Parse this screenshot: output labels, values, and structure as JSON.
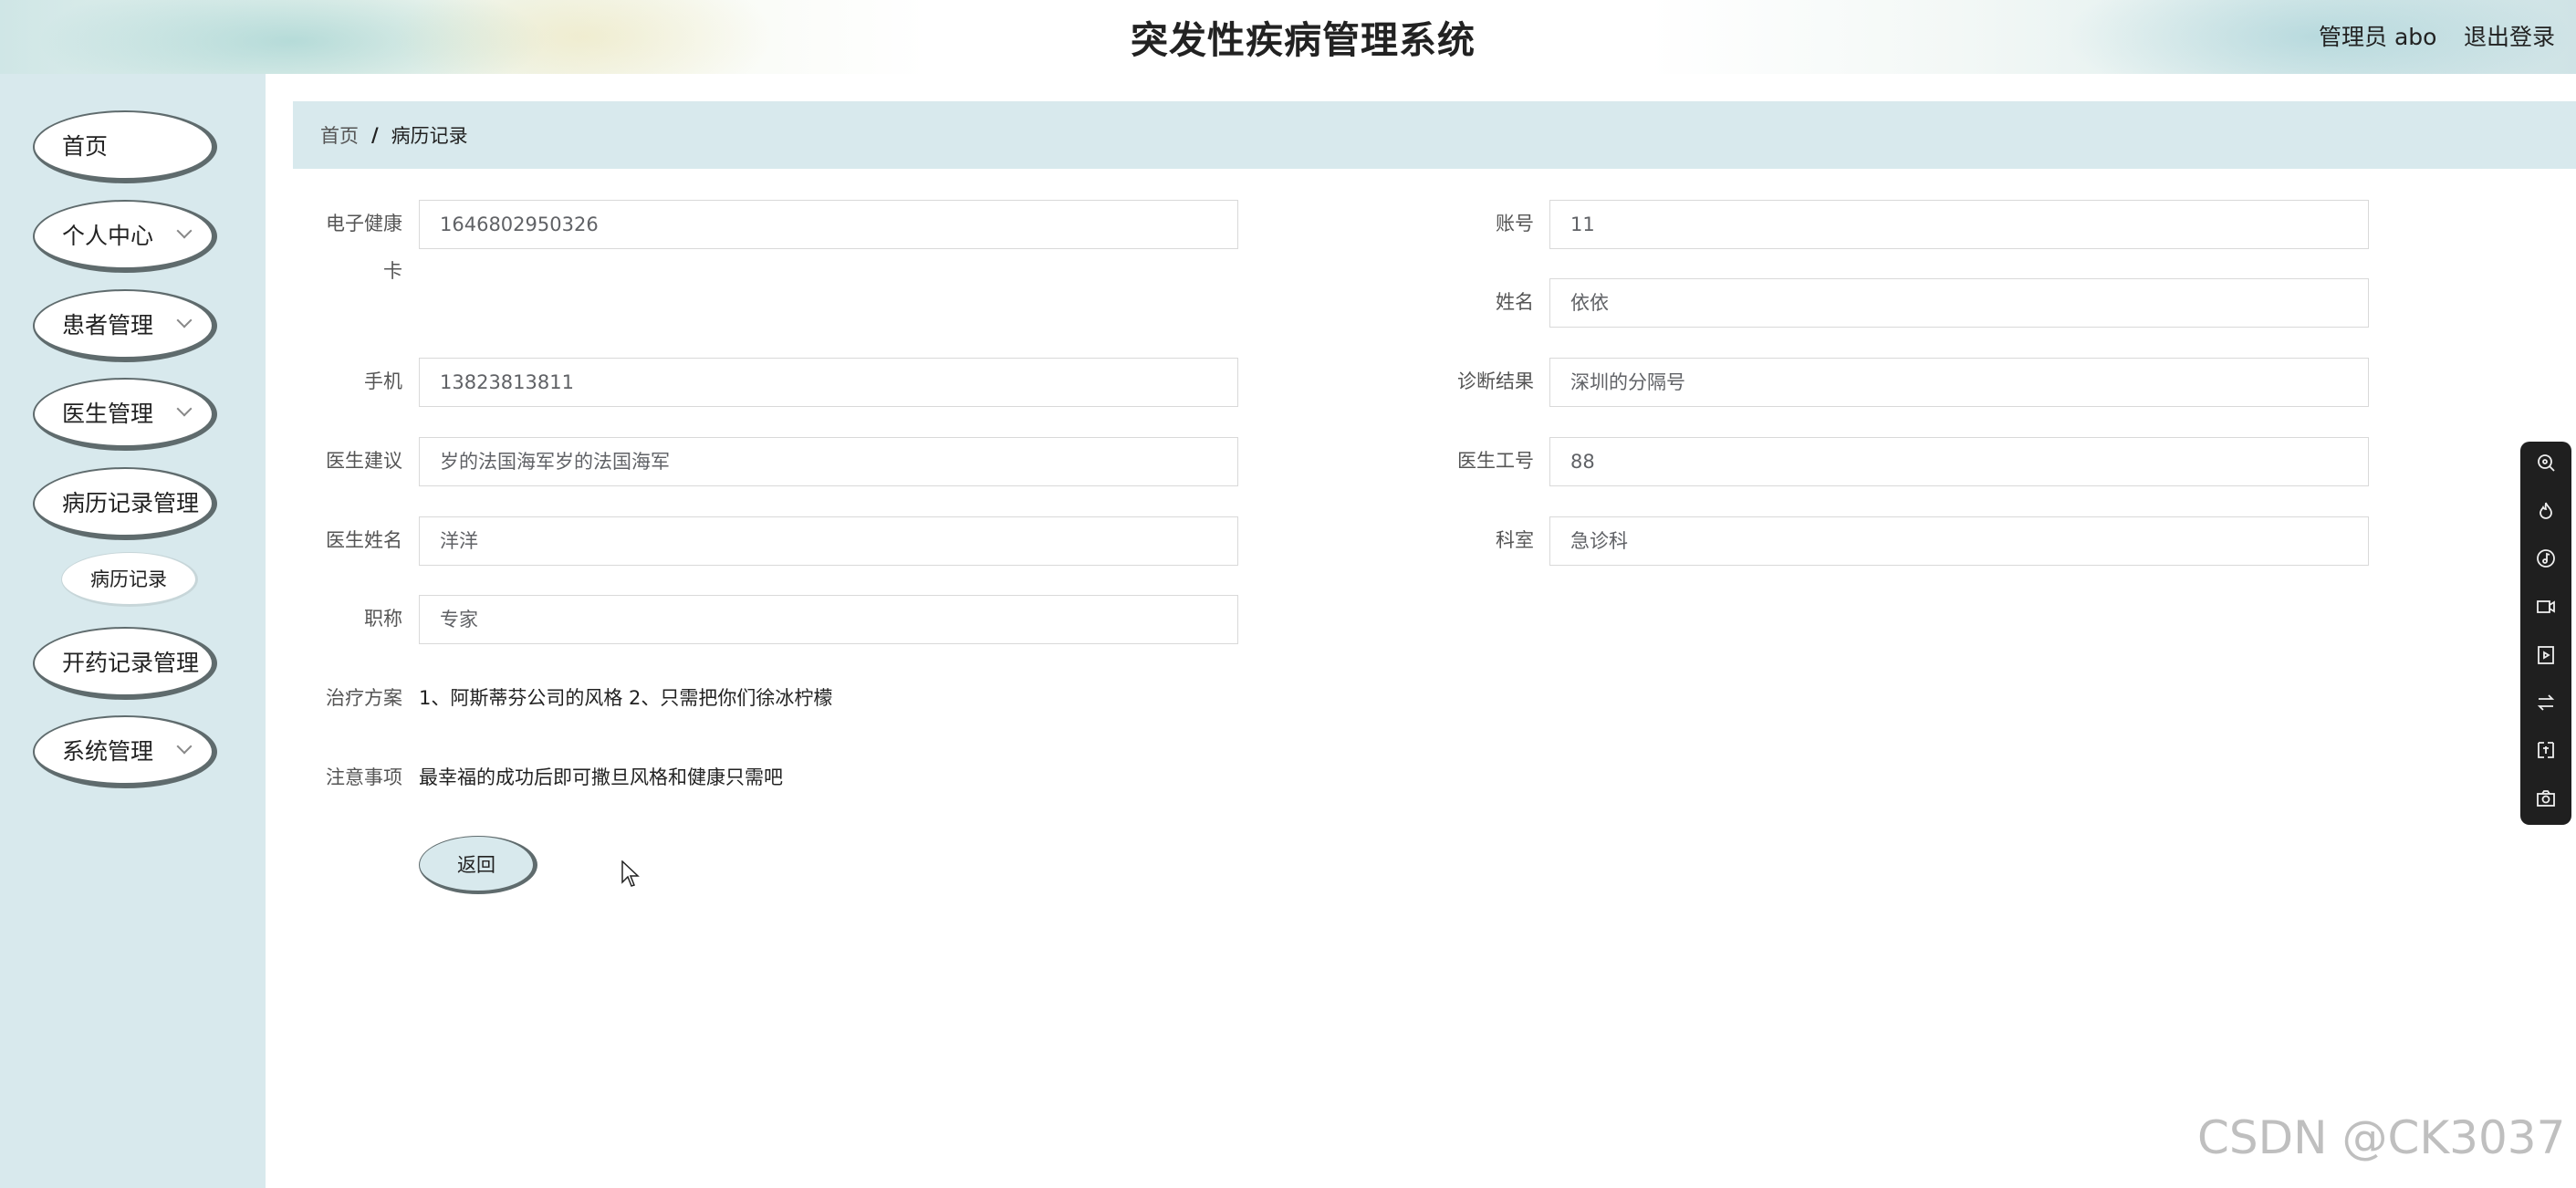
{
  "header": {
    "title": "突发性疾病管理系统",
    "user_label": "管理员 abo",
    "logout_label": "退出登录"
  },
  "sidebar": {
    "items": [
      {
        "label": "首页",
        "has_submenu": false
      },
      {
        "label": "个人中心",
        "has_submenu": true
      },
      {
        "label": "患者管理",
        "has_submenu": true
      },
      {
        "label": "医生管理",
        "has_submenu": true
      },
      {
        "label": "病历记录管理",
        "has_submenu": false
      },
      {
        "label": "开药记录管理",
        "has_submenu": false
      },
      {
        "label": "系统管理",
        "has_submenu": true
      }
    ],
    "subitem": {
      "label": "病历记录"
    }
  },
  "breadcrumb": {
    "home": "首页",
    "separator": "/",
    "current": "病历记录"
  },
  "form": {
    "health_card": {
      "label_line1": "电子健康",
      "label_line2": "卡",
      "value": "1646802950326"
    },
    "account": {
      "label": "账号",
      "value": "11"
    },
    "name": {
      "label": "姓名",
      "value": "依依"
    },
    "phone": {
      "label": "手机",
      "value": "13823813811"
    },
    "diagnosis": {
      "label": "诊断结果",
      "value": "深圳的分隔号"
    },
    "doctor_advice": {
      "label": "医生建议",
      "value": "岁的法国海军岁的法国海军"
    },
    "doctor_id": {
      "label": "医生工号",
      "value": "88"
    },
    "doctor_name": {
      "label": "医生姓名",
      "value": "洋洋"
    },
    "department": {
      "label": "科室",
      "value": "急诊科"
    },
    "title": {
      "label": "职称",
      "value": "专家"
    },
    "treatment": {
      "label": "治疗方案",
      "value": "1、阿斯蒂芬公司的风格 2、只需把你们徐冰柠檬"
    },
    "notes": {
      "label": "注意事项",
      "value": "最幸福的成功后即可撒旦风格和健康只需吧"
    },
    "back_button": "返回"
  },
  "toolbar": {
    "icons": [
      "search-icon",
      "flame-icon",
      "music-icon",
      "video-icon",
      "play-frame-icon",
      "swap-icon",
      "translate-icon",
      "camera-icon"
    ]
  },
  "watermark": "CSDN @CK3037"
}
